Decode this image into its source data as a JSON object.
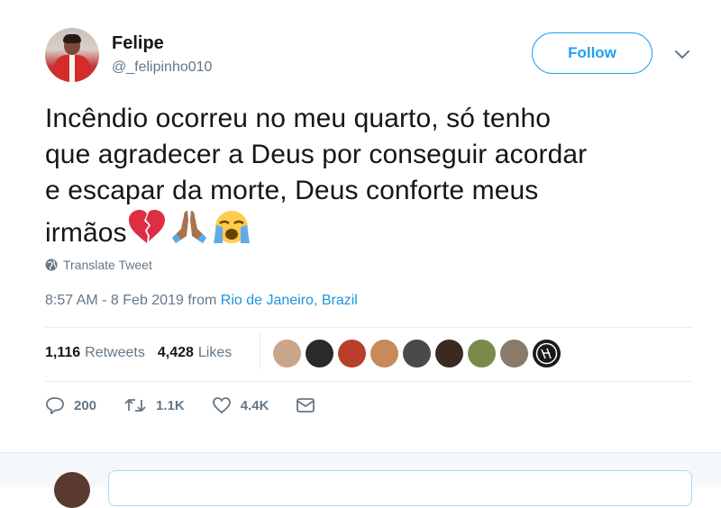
{
  "user": {
    "name": "Felipe",
    "handle": "@_felipinho010",
    "follow_label": "Follow"
  },
  "tweet": {
    "lines": [
      "Incêndio ocorreu no meu quarto, só tenho",
      "que agradecer a Deus por conseguir acordar",
      "e escapar da morte, Deus conforte meus",
      "irmãos"
    ],
    "emojis": [
      "broken-heart-icon",
      "folded-hands-icon",
      "crying-face-icon"
    ],
    "translate_label": "Translate Tweet",
    "time": "8:57 AM - 8 Feb 2019 from ",
    "location": "Rio de Janeiro, Brazil"
  },
  "stats": {
    "retweets_count": "1,116",
    "retweets_label": "Retweets",
    "likes_count": "4,428",
    "likes_label": "Likes"
  },
  "likers": [
    "#c9a58a",
    "#2a2a2a",
    "#b8402a",
    "#c88a5a",
    "#4a4a4a",
    "#3a2a22",
    "#7a8a4a",
    "#8a7a6a",
    "#1a1a1a"
  ],
  "actions": {
    "reply_count": "200",
    "retweet_count": "1.1K",
    "like_count": "4.4K"
  },
  "colors": {
    "accent": "#1da1f2",
    "link": "#1b95e0",
    "muted": "#657786"
  }
}
